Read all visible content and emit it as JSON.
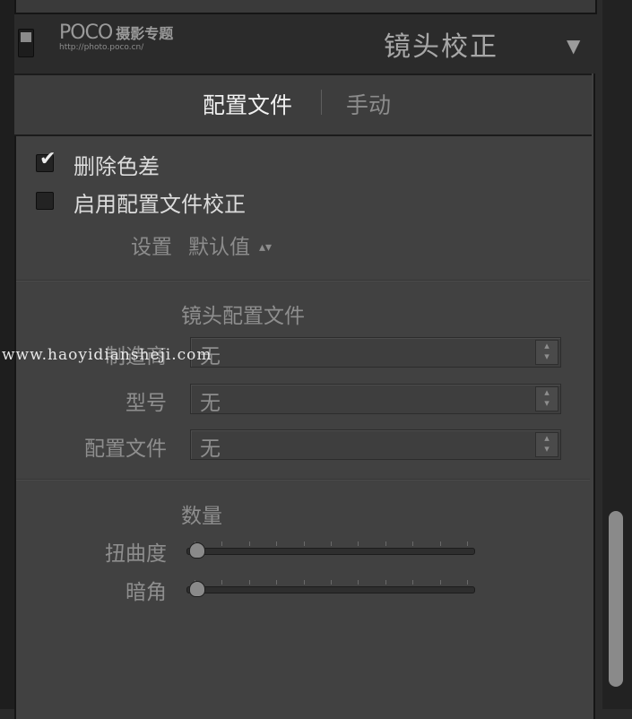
{
  "header": {
    "logo_brand": "POCO",
    "logo_tag": "摄影专题",
    "logo_url": "http://photo.poco.cn/",
    "title": "镜头校正",
    "collapse_icon": "triangle-down-icon"
  },
  "tabs": [
    {
      "label": "配置文件",
      "active": true
    },
    {
      "label": "手动",
      "active": false
    }
  ],
  "options": {
    "remove_ca": {
      "label": "删除色差",
      "checked": true
    },
    "enable_profile": {
      "label": "启用配置文件校正",
      "checked": false
    }
  },
  "setup": {
    "label": "设置",
    "value": "默认值"
  },
  "lens_profile": {
    "title": "镜头配置文件",
    "fields": [
      {
        "label": "制造商",
        "value": "无"
      },
      {
        "label": "型号",
        "value": "无"
      },
      {
        "label": "配置文件",
        "value": "无"
      }
    ]
  },
  "amount": {
    "title": "数量",
    "sliders": [
      {
        "label": "扭曲度",
        "value": 0
      },
      {
        "label": "暗角",
        "value": 0
      }
    ]
  },
  "watermark": "www.haoyidiansheji.com",
  "colors": {
    "panel": "#414141",
    "background": "#2b2b2b",
    "active_text": "#f0f0f0",
    "disabled_text": "#8e8e8e"
  }
}
